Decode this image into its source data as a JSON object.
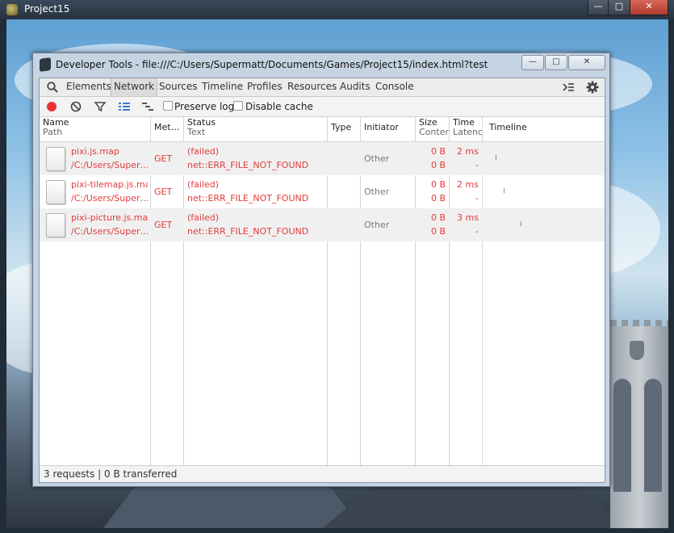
{
  "window": {
    "title": "Project15"
  },
  "devtools": {
    "title": "Developer Tools - file:///C:/Users/Supermatt/Documents/Games/Project15/index.html?test",
    "tabs": [
      {
        "label": "Elements"
      },
      {
        "label": "Network",
        "active": true
      },
      {
        "label": "Sources"
      },
      {
        "label": "Timeline"
      },
      {
        "label": "Profiles"
      },
      {
        "label": "Resources"
      },
      {
        "label": "Audits"
      },
      {
        "label": "Console"
      }
    ],
    "toolbar": {
      "preserve_log": "Preserve log",
      "disable_cache": "Disable cache"
    },
    "columns": {
      "name": "Name",
      "path": "Path",
      "method": "Met…",
      "status": "Status",
      "text": "Text",
      "type": "Type",
      "initiator": "Initiator",
      "size": "Size",
      "content": "Conter",
      "time": "Time",
      "latency": "Latenc",
      "timeline": "Timeline"
    },
    "requests": [
      {
        "name": "pixi.js.map",
        "path": "/C:/Users/Super…",
        "method": "GET",
        "status": "(failed)",
        "text": "net::ERR_FILE_NOT_FOUND",
        "type": "",
        "initiator": "Other",
        "size": "0 B",
        "content": "0 B",
        "time": "2 ms",
        "latency": "-"
      },
      {
        "name": "pixi-tilemap.js.map",
        "path": "/C:/Users/Super…",
        "method": "GET",
        "status": "(failed)",
        "text": "net::ERR_FILE_NOT_FOUND",
        "type": "",
        "initiator": "Other",
        "size": "0 B",
        "content": "0 B",
        "time": "2 ms",
        "latency": "-"
      },
      {
        "name": "pixi-picture.js.map",
        "path": "/C:/Users/Super…",
        "method": "GET",
        "status": "(failed)",
        "text": "net::ERR_FILE_NOT_FOUND",
        "type": "",
        "initiator": "Other",
        "size": "0 B",
        "content": "0 B",
        "time": "3 ms",
        "latency": "-"
      }
    ],
    "status_bar": "3 requests | 0 B transferred"
  },
  "colors": {
    "error_text": "#e23b3b",
    "record_active": "#e83232",
    "accent_blue": "#3a7bd5"
  },
  "icons": {
    "search": "search-icon",
    "record": "record-icon",
    "clear": "clear-icon",
    "filter": "filter-icon",
    "list_view": "list-view-icon",
    "overview": "waterfall-icon",
    "console_drawer": "console-drawer-icon",
    "settings": "gear-icon"
  }
}
